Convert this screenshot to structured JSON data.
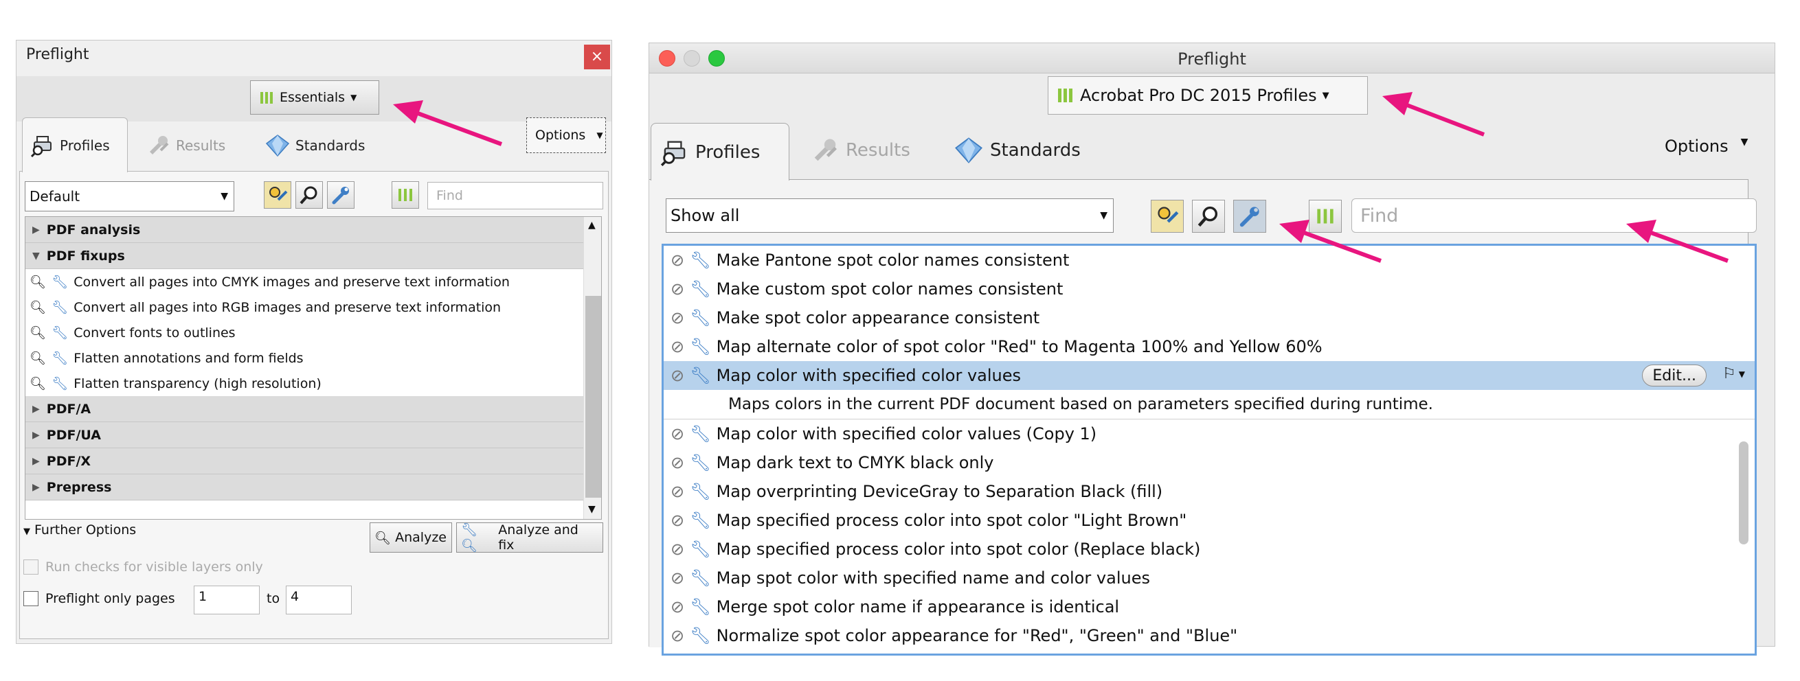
{
  "left_window": {
    "title": "Preflight",
    "close_glyph": "×",
    "profile_library_button": "Essentials",
    "options_button": "Options",
    "tabs": [
      {
        "label": "Profiles",
        "icon": "printer-magnifier-icon",
        "state": "active"
      },
      {
        "label": "Results",
        "icon": "results-wrench-icon",
        "state": "disabled"
      },
      {
        "label": "Standards",
        "icon": "diamond-icon",
        "state": "normal"
      }
    ],
    "filter_dropdown_value": "Default",
    "find_placeholder": "Find",
    "groups_before": [
      {
        "label": "PDF analysis",
        "expanded": false
      },
      {
        "label": "PDF fixups",
        "expanded": true
      }
    ],
    "fixup_items": [
      "Convert all pages into CMYK images and preserve text information",
      "Convert all pages into RGB images and preserve text information",
      "Convert fonts to outlines",
      "Flatten annotations and form fields",
      "Flatten transparency (high resolution)"
    ],
    "groups_after": [
      {
        "label": "PDF/A",
        "expanded": false
      },
      {
        "label": "PDF/UA",
        "expanded": false
      },
      {
        "label": "PDF/X",
        "expanded": false
      },
      {
        "label": "Prepress",
        "expanded": false
      }
    ],
    "further_options": "Further Options",
    "analyze_button": "Analyze",
    "analyze_fix_button": "Analyze and fix",
    "visible_layers_label": "Run checks for visible layers only",
    "pages_label": "Preflight only pages",
    "page_from": "1",
    "page_to": "4",
    "to_label": "to"
  },
  "right_window": {
    "title": "Preflight",
    "profile_library_button": "Acrobat Pro DC 2015 Profiles",
    "options_button": "Options",
    "tabs": [
      {
        "label": "Profiles",
        "icon": "printer-magnifier-icon",
        "state": "active"
      },
      {
        "label": "Results",
        "icon": "results-wrench-icon",
        "state": "disabled"
      },
      {
        "label": "Standards",
        "icon": "diamond-icon",
        "state": "normal"
      }
    ],
    "filter_dropdown_value": "Show all",
    "find_placeholder": "Find",
    "items": [
      "Make Pantone spot color names consistent",
      "Make custom spot color names consistent",
      "Make spot color appearance consistent",
      "Map alternate color of spot color \"Red\" to Magenta 100% and Yellow 60%",
      "Map color with specified color values",
      "Map color with specified color values (Copy 1)",
      "Map dark text to CMYK black only",
      "Map overprinting DeviceGray to Separation Black (fill)",
      "Map specified process color into spot color \"Light Brown\"",
      "Map specified process color into spot color (Replace black)",
      "Map spot color with specified name and color values",
      "Merge spot color name if appearance is identical",
      "Normalize spot color appearance for \"Red\", \"Green\" and \"Blue\""
    ],
    "selected_description": "Maps colors in the current PDF document based on parameters specified during runtime.",
    "edit_button": "Edit..."
  },
  "accent_colors": {
    "arrow": "#e8157f",
    "selection": "#b7d2ec",
    "library_icon": "#8cc63f"
  }
}
